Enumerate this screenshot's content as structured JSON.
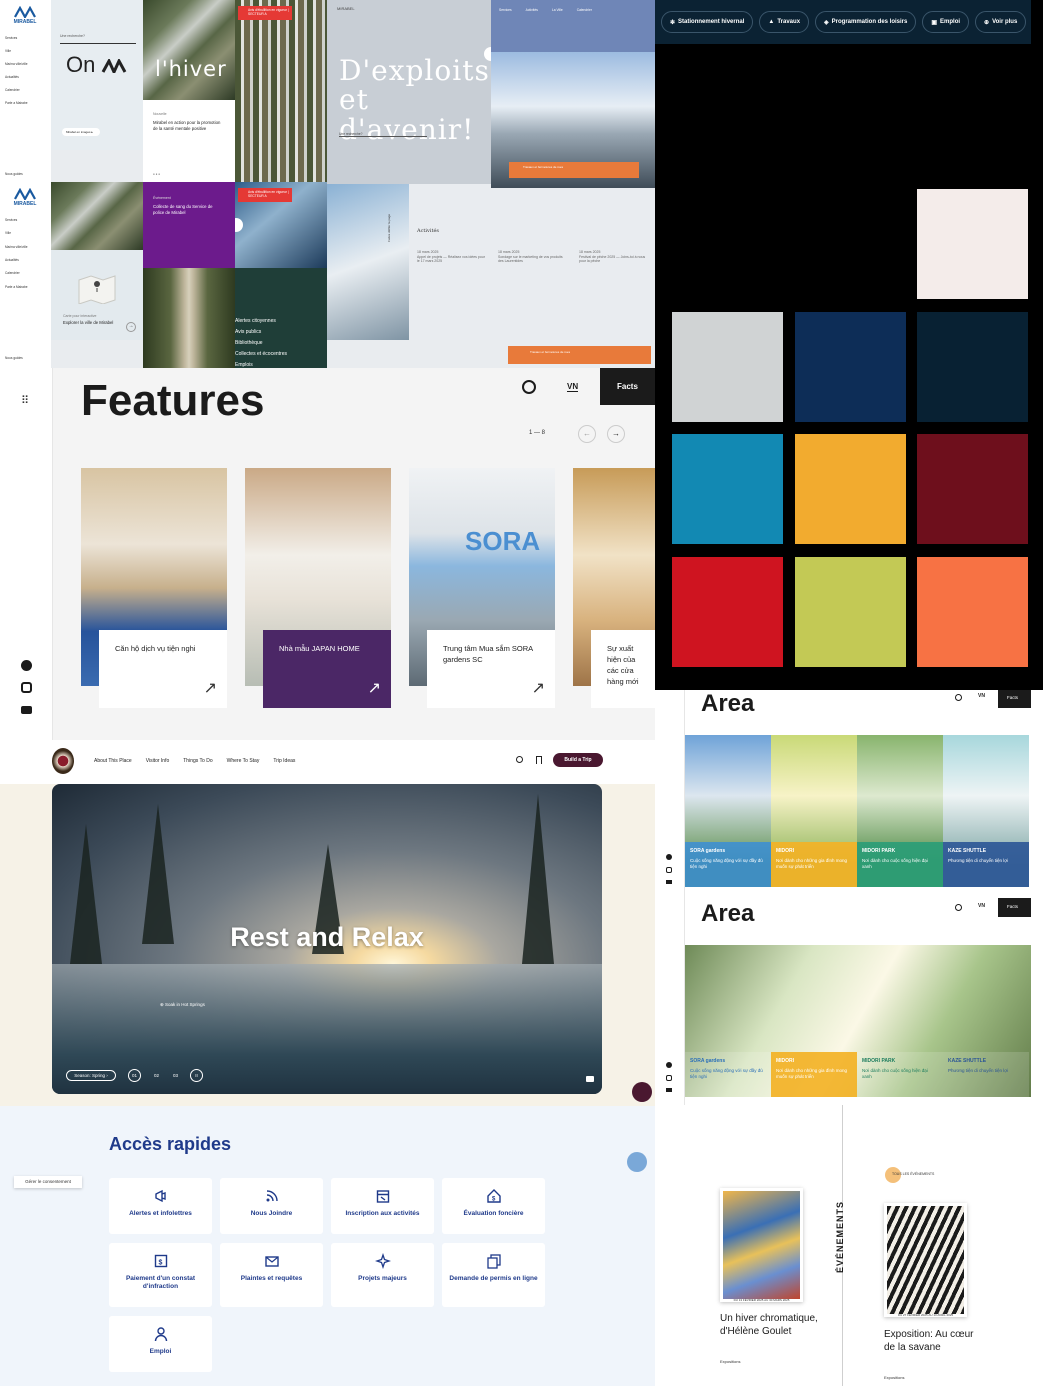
{
  "mirabel": {
    "logo": "MIRABEL",
    "nav_items": [
      "Services",
      "Ville",
      "Ma/ma ville/ville",
      "Actualités",
      "Calendrier",
      "Parle a Mairabe"
    ],
    "nav_items_b": [
      "Services",
      "Ville",
      "Ma/ma ville/ville",
      "Actualités",
      "Calendrier",
      "Parle a Mairabe"
    ],
    "footer_small": "Nous guides",
    "on_text": "On",
    "search_placeholder": "Une recherche?",
    "hiver": "l'hiver",
    "news_card": "Mirabel en action pour la promotion de la santé mentale positive",
    "news_tag": "Nouvelle",
    "collecte": "Collecte de sang du Service de police de Mirabel",
    "collecte_tag": "Événement",
    "alert_1": "Avis d'ébullition en vigueur | SECTEUR A",
    "alert_2": "Avis d'ébullition en vigueur | SECTEUR A",
    "explorer_small": "Carte pour interactive",
    "explorer": "Explorer la ville de Mirabel",
    "exploits": "D'exploits et d'avenir!",
    "activities_title": "Activités",
    "activities": [
      {
        "date": "18 mars 2025",
        "text": "Appel de projets — Réalisez vos idées pour le 17 mars 2025"
      },
      {
        "date": "18 mars 2025",
        "text": "Sondage sur le marketing de vos produits des Laurentides"
      },
      {
        "date": "18 mars 2025",
        "text": "Festival de pêche 2025 — Joins-toi à nous pour la pêche"
      }
    ],
    "links": [
      "Alertes citoyennes",
      "Avis publics",
      "Bibliothèque",
      "Collectes et écocentres",
      "Emplois"
    ],
    "scroll_label": "Faites défiler la page",
    "collecte_link": "Voir les collectes",
    "header_links": [
      "Services",
      "Activités",
      "La Ville",
      "Calendrier"
    ],
    "orange_banner": "Travaux et fermetures de rues"
  },
  "header_bar": {
    "pills": [
      "Stationnement hivernal",
      "Travaux",
      "Programmation des loisirs",
      "Emploi",
      "Voir plus"
    ],
    "icons": [
      "snowflake-icon",
      "cone-icon",
      "ticket-icon",
      "briefcase-icon",
      "plus-icon"
    ]
  },
  "palette": {
    "colors": [
      "#f4ecea",
      "#d0d3d4",
      "#0d2d57",
      "#082133",
      "#1289b3",
      "#f2ab2f",
      "#6e0f1c",
      "#cf1420",
      "#c3c955",
      "#f77244"
    ]
  },
  "features": {
    "title": "Features",
    "lang": "VN",
    "facts": "Facts",
    "pager": "1 — 8",
    "cards": [
      {
        "label": "Căn hộ dịch vụ tiện nghi",
        "accent": "#4b2a80",
        "labelbg": "#ffffff",
        "labelcolor": "#222222"
      },
      {
        "label": "Nhà mẫu JAPAN HOME",
        "accent": "#4b2a70",
        "labelbg": "#4b2766",
        "labelcolor": "#ffffff"
      },
      {
        "label": "Trung tâm Mua sắm SORA gardens SC",
        "accent": "#3d8fd4",
        "labelbg": "#ffffff",
        "labelcolor": "#222222"
      },
      {
        "label": "Sự xuất hiện của các cửa hàng mới",
        "accent": "#f2b72b",
        "labelbg": "#ffffff",
        "labelcolor": "#222222"
      }
    ]
  },
  "area": {
    "title": "Area",
    "lang": "VN",
    "facts": "Facts",
    "cards": [
      {
        "name": "SORA gardens",
        "desc": "Cuộc sống năng động với sự đầy đủ tiện nghi",
        "color": "#3b8ed6"
      },
      {
        "name": "MIDORI",
        "desc": "Nơi dành cho những gia đình mong muốn sự phát triển",
        "color": "#f3b226"
      },
      {
        "name": "MIDORI PARK",
        "desc": "Nơi dành cho cuộc sống hiện đại xanh",
        "color": "#2a9d78"
      },
      {
        "name": "KAZE SHUTTLE",
        "desc": "Phương tiện di chuyển tiện lợi",
        "color": "#2b5596"
      }
    ]
  },
  "banff": {
    "nav": [
      "About This Place",
      "Visitor Info",
      "Things To Do",
      "Where To Stay",
      "Trip Ideas"
    ],
    "cta": "Build a Trip",
    "hero_title": "Rest and Relax",
    "hero_link": "Soak in Hot Springs",
    "season": "Season: Spring",
    "slides": [
      "01",
      "02",
      "03"
    ]
  },
  "acces": {
    "title": "Accès rapides",
    "consent": "Gérer le consentement",
    "items": [
      {
        "label": "Alertes et infolettres",
        "icon": "megaphone-icon"
      },
      {
        "label": "Nous Joindre",
        "icon": "rss-icon"
      },
      {
        "label": "Inscription aux activités",
        "icon": "calendar-icon"
      },
      {
        "label": "Évaluation foncière",
        "icon": "house-dollar-icon"
      },
      {
        "label": "Paiement d'un constat d'infraction",
        "icon": "ticket-dollar-icon"
      },
      {
        "label": "Plaintes et requêtes",
        "icon": "mail-check-icon"
      },
      {
        "label": "Projets majeurs",
        "icon": "sparkle-icon"
      },
      {
        "label": "Demande de permis en ligne",
        "icon": "documents-icon"
      },
      {
        "label": "Emploi",
        "icon": "person-icon"
      }
    ]
  },
  "events": {
    "vertical": "ÉVÉNEMENTS",
    "all_link": "TOUS LES ÉVÉNEMENTS",
    "items": [
      {
        "dates": "DU 13 FÉVRIER 2025 AU 30 MARS 2025",
        "title": "Un hiver chromatique, d'Hélène Goulet",
        "cat": "Expositions"
      },
      {
        "dates": "DU 27 FÉVRIER 2025 AU 13 AVRIL 2025",
        "title": "Exposition: Au cœur de la savane",
        "cat": "Expositions"
      }
    ]
  }
}
